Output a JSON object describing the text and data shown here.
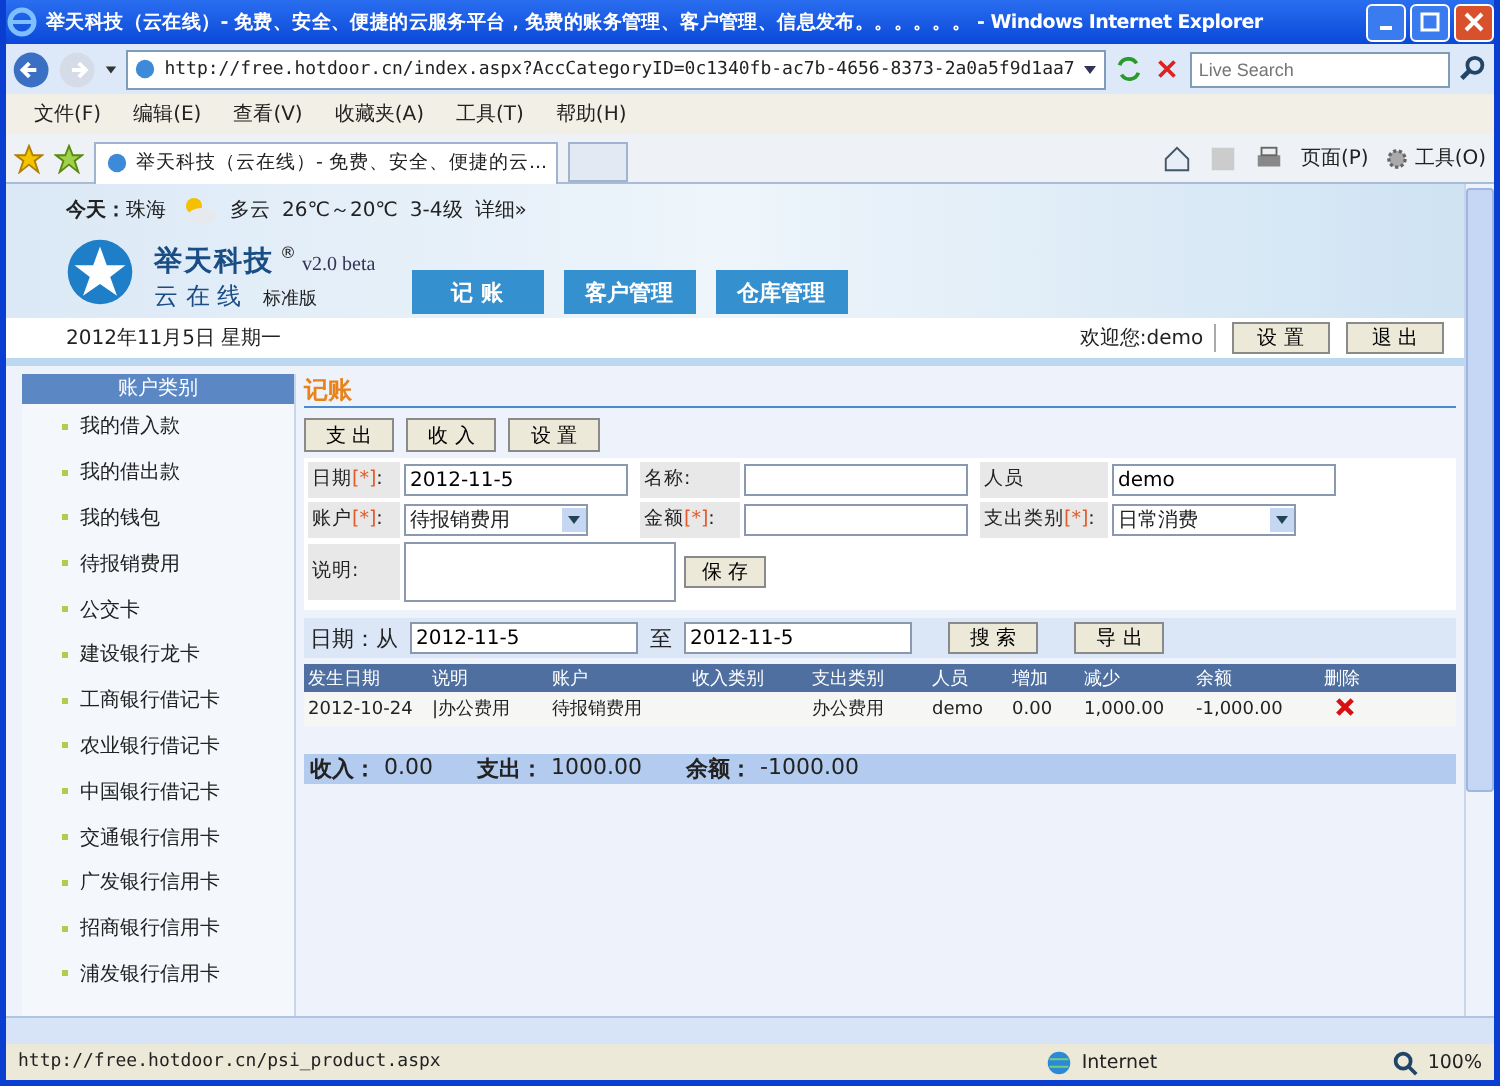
{
  "window": {
    "title": "举天科技（云在线）- 免费、安全、便捷的云服务平台，免费的账务管理、客户管理、信息发布。。。。。。 - Windows Internet Explorer"
  },
  "address_bar": {
    "url": "http://free.hotdoor.cn/index.aspx?AccCategoryID=0c1340fb-ac7b-4656-8373-2a0a5f9d1aa7",
    "search_placeholder": "Live Search"
  },
  "menu_bar": [
    "文件(F)",
    "编辑(E)",
    "查看(V)",
    "收藏夹(A)",
    "工具(T)",
    "帮助(H)"
  ],
  "tabs": [
    {
      "label": "举天科技（云在线）- 免费、安全、便捷的云...",
      "selected": true
    }
  ],
  "command_bar": [
    "页面(P)",
    "工具(O)"
  ],
  "page": {
    "weather": {
      "label": "今天：",
      "city": "珠海",
      "condition": "多云",
      "temperature": "26℃～20℃",
      "wind": "3-4级",
      "link": "详细»"
    },
    "logo": {
      "name": "举天科技",
      "mark": "®",
      "subtitle": "云 在 线",
      "version": "v2.0 beta",
      "edition": "标准版"
    },
    "nav": [
      "记 账",
      "客户管理",
      "仓库管理"
    ],
    "date": "2012年11月5日 星期一",
    "welcome": "欢迎您:demo",
    "header_buttons": [
      "设 置",
      "退 出"
    ],
    "sidebar": {
      "title": "账户类别",
      "items": [
        "我的借入款",
        "我的借出款",
        "我的钱包",
        "待报销费用",
        "公交卡",
        "建设银行龙卡",
        "工商银行借记卡",
        "农业银行借记卡",
        "中国银行借记卡",
        "交通银行信用卡",
        "广发银行信用卡",
        "招商银行信用卡",
        "浦发银行信用卡"
      ]
    },
    "main": {
      "title": "记账",
      "action_buttons": [
        "支 出",
        "收 入",
        "设 置"
      ],
      "form_rows": [
        [
          {
            "kind": "input",
            "label": "日期",
            "required_mark": "[*]",
            "colon": ":",
            "value": "2012-11-5"
          },
          {
            "kind": "input",
            "label": "名称:"
          },
          {
            "kind": "input",
            "label": "人员",
            "value": "demo"
          }
        ],
        [
          {
            "kind": "select",
            "label": "账户",
            "required_mark": "[*]",
            "colon": ":",
            "value": "待报销费用"
          },
          {
            "kind": "input",
            "label": "金额",
            "required_mark": "[*]",
            "colon": ":"
          },
          {
            "kind": "select",
            "label": "支出类别",
            "required_mark": "[*]",
            "colon": ":",
            "value": "日常消费"
          }
        ],
        [
          {
            "kind": "textarea",
            "label": "说明:"
          },
          {
            "kind": "button",
            "label": "保 存"
          }
        ]
      ],
      "filter": {
        "from_label": "日期：从",
        "from": "2012-11-5",
        "to_label": "至",
        "to": "2012-11-5",
        "buttons": [
          "搜 索",
          "导 出"
        ]
      },
      "table": {
        "columns": [
          "发生日期",
          "说明",
          "账户",
          "收入类别",
          "支出类别",
          "人员",
          "增加",
          "减少",
          "余额",
          "删除"
        ],
        "rows": [
          [
            "2012-10-24",
            "|办公费用",
            "待报销费用",
            "",
            "办公费用",
            "demo",
            "0.00",
            "1,000.00",
            "-1,000.00"
          ]
        ]
      },
      "totals": [
        {
          "label": "收入：",
          "value": "0.00"
        },
        {
          "label": "支出：",
          "value": "1000.00"
        },
        {
          "label": "余额：",
          "value": "-1000.00"
        }
      ]
    }
  },
  "status_bar": {
    "url": "http://free.hotdoor.cn/psi_product.aspx",
    "zone": "Internet",
    "zoom": "100%"
  }
}
